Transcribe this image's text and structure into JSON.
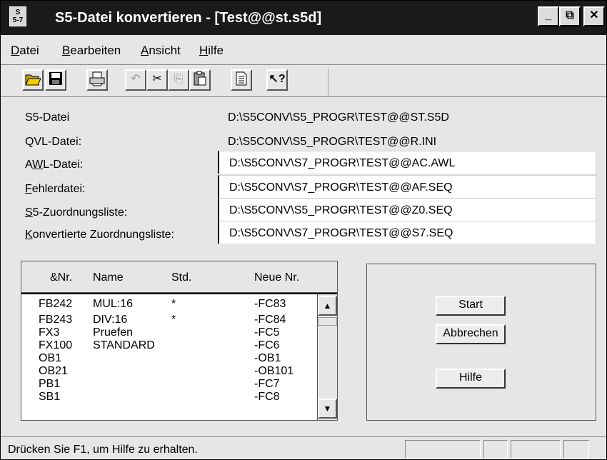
{
  "window": {
    "title": "S5-Datei konvertieren - [Test@@st.s5d]",
    "icon_text": "S\n5-7"
  },
  "titlebar_buttons": {
    "minimize": "_",
    "maximize": "⧉",
    "close": "✕"
  },
  "menu": [
    {
      "u": "D",
      "rest": "atei"
    },
    {
      "u": "B",
      "rest": "earbeiten"
    },
    {
      "u": "A",
      "rest": "nsicht"
    },
    {
      "u": "H",
      "rest": "ilfe"
    }
  ],
  "toolbar_icons": [
    "open-folder-icon",
    "save-icon",
    "print-icon",
    "undo-icon",
    "cut-icon",
    "copy-icon",
    "paste-icon",
    "properties-icon",
    "context-help-icon"
  ],
  "form": {
    "s5_label": "S5-Datei",
    "s5_value": "D:\\S5CONV\\S5_PROGR\\TEST@@ST.S5D",
    "qvl_label": "QVL-Datei:",
    "qvl_value": "D:\\S5CONV\\S5_PROGR\\TEST@@R.INI",
    "awl_label_a": "A",
    "awl_label_u": "W",
    "awl_label_rest": "L-Datei:",
    "awl_value": "D:\\S5CONV\\S7_PROGR\\TEST@@AC.AWL",
    "fehler_label_u": "F",
    "fehler_label_rest": "ehlerdatei:",
    "fehler_value": "D:\\S5CONV\\S7_PROGR\\TEST@@AF.SEQ",
    "s5z_label_u": "S",
    "s5z_label_rest": "5-Zuordnungsliste:",
    "s5z_value": "D:\\S5CONV\\S5_PROGR\\TEST@@Z0.SEQ",
    "konv_label_u": "K",
    "konv_label_rest": "onvertierte Zuordnungsliste:",
    "konv_value": "D:\\S5CONV\\S7_PROGR\\TEST@@S7.SEQ"
  },
  "list": {
    "columns": [
      "&Nr.",
      "Name",
      "Std.",
      "Neue Nr."
    ],
    "rows": [
      {
        "nr": "FB242",
        "name": "MUL:16",
        "std": "*",
        "neu": "-FC83"
      },
      {
        "nr": "FB243",
        "name": "DIV:16",
        "std": "*",
        "neu": "-FC84"
      },
      {
        "nr": "FX3",
        "name": "Pruefen",
        "std": "",
        "neu": "-FC5"
      },
      {
        "nr": "FX100",
        "name": "STANDARD",
        "std": "",
        "neu": "-FC6"
      },
      {
        "nr": "OB1",
        "name": "",
        "std": "",
        "neu": "-OB1"
      },
      {
        "nr": "OB21",
        "name": "",
        "std": "",
        "neu": "-OB101"
      },
      {
        "nr": "PB1",
        "name": "",
        "std": "",
        "neu": "-FC7"
      },
      {
        "nr": "SB1",
        "name": "",
        "std": "",
        "neu": "-FC8"
      }
    ]
  },
  "buttons": {
    "start": "Start",
    "abbrechen": "Abbrechen",
    "hilfe": "Hilfe"
  },
  "status": {
    "text": "Drücken Sie F1, um Hilfe zu erhalten."
  },
  "colors": {
    "titlebar": "#1a1a1a",
    "face": "#e6e6e6",
    "field": "#ffffff"
  }
}
